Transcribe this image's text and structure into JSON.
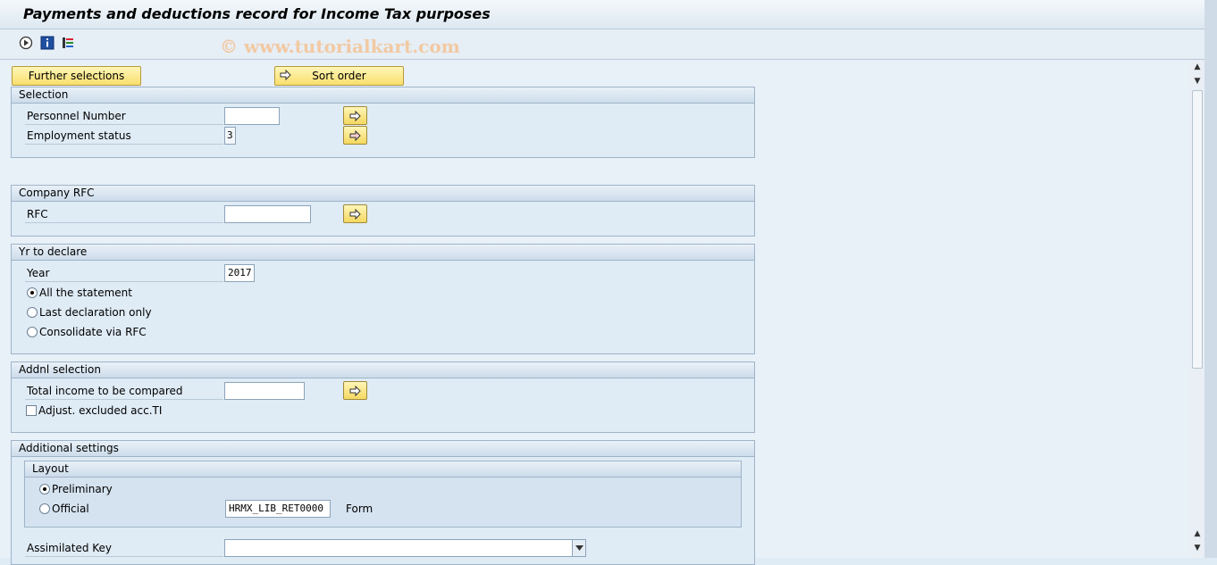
{
  "window": {
    "title": "Payments and deductions record for Income Tax purposes"
  },
  "toolbar": {
    "icons": [
      "execute-icon",
      "info-icon",
      "variant-icon"
    ],
    "watermark": "© www.tutorialkart.com"
  },
  "buttons": {
    "further_selections": "Further selections",
    "sort_order": "Sort order"
  },
  "selection": {
    "header": "Selection",
    "personnel_number_label": "Personnel Number",
    "personnel_number_value": "",
    "employment_status_label": "Employment status",
    "employment_status_value": "3"
  },
  "company_rfc": {
    "header": "Company RFC",
    "rfc_label": "RFC",
    "rfc_value": ""
  },
  "year_to_declare": {
    "header": "Yr to declare",
    "year_label": "Year",
    "year_value": "2017",
    "options": [
      {
        "label": "All the statement",
        "selected": true
      },
      {
        "label": "Last declaration only",
        "selected": false
      },
      {
        "label": "Consolidate via RFC",
        "selected": false
      }
    ]
  },
  "addnl_selection": {
    "header": "Addnl selection",
    "total_income_label": "Total income to be compared",
    "total_income_value": "",
    "adjust_excluded_label": "Adjust. excluded acc.TI",
    "adjust_excluded_checked": false
  },
  "additional_settings": {
    "header": "Additional settings",
    "layout": {
      "header": "Layout",
      "options": [
        {
          "label": "Preliminary",
          "selected": true
        },
        {
          "label": "Official",
          "selected": false
        }
      ],
      "form_value": "HRMX_LIB_RET0000",
      "form_label": "Form"
    },
    "assimilated_key_label": "Assimilated Key",
    "assimilated_key_value": ""
  }
}
